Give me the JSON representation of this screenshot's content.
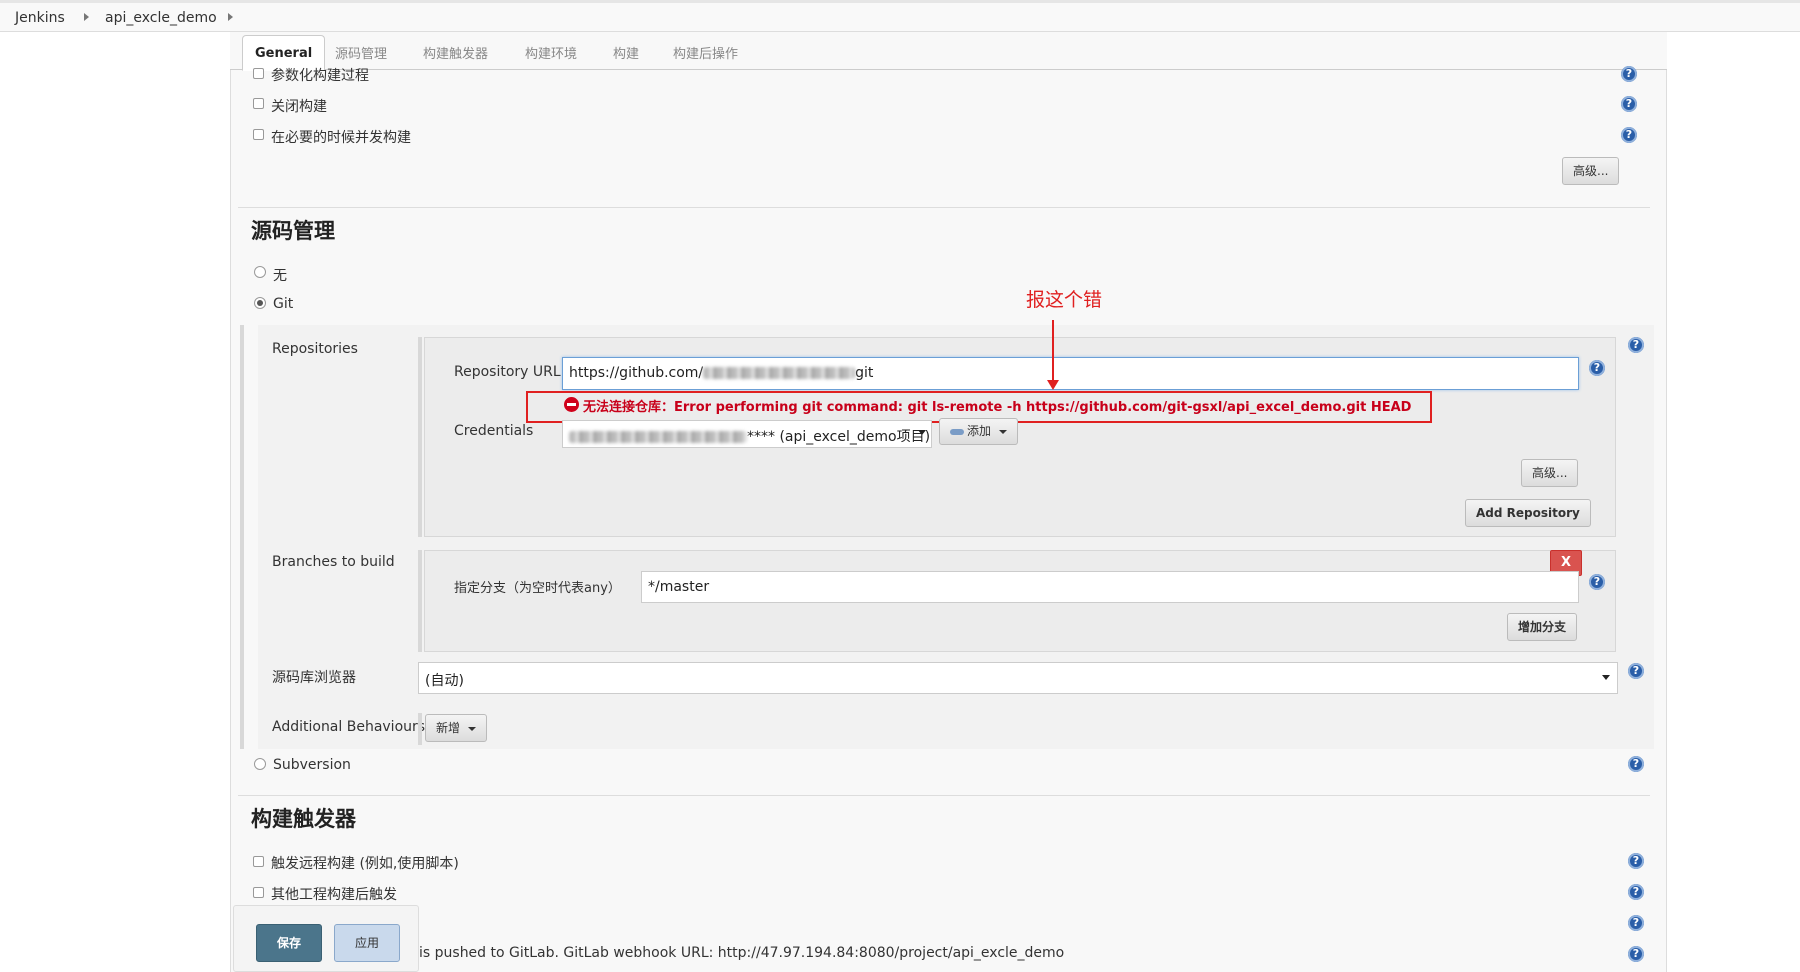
{
  "breadcrumb": {
    "root": "Jenkins",
    "project": "api_excle_demo"
  },
  "tabs": [
    "General",
    "源码管理",
    "构建触发器",
    "构建环境",
    "构建",
    "构建后操作"
  ],
  "general": {
    "opt_param": "参数化构建过程",
    "opt_disable": "关闭构建",
    "opt_concurrent": "在必要的时候并发构建",
    "advanced": "高级..."
  },
  "scm": {
    "title": "源码管理",
    "none_label": "无",
    "git_label": "Git",
    "repositories_label": "Repositories",
    "repo_url_label": "Repository URL",
    "repo_url_prefix": "https://github.com/",
    "repo_url_suffix": "git",
    "error_message": "无法连接仓库：Error performing git command: git ls-remote -h https://github.com/git-gsxl/api_excel_demo.git HEAD",
    "credentials_label": "Credentials",
    "credentials_value": "**** (api_excel_demo项目)",
    "add_button": "添加",
    "advanced": "高级...",
    "add_repository": "Add Repository",
    "branches_label": "Branches to build",
    "branch_specifier_label": "指定分支（为空时代表any）",
    "branch_value": "*/master",
    "remove_button": "X",
    "add_branch": "增加分支",
    "browser_label": "源码库浏览器",
    "browser_value": "(自动)",
    "behaviours_label": "Additional Behaviours",
    "behaviours_add": "新增",
    "subversion_label": "Subversion"
  },
  "annotation": {
    "text": "报这个错"
  },
  "triggers": {
    "title": "构建触发器",
    "opt_remote": "触发远程构建 (例如,使用脚本)",
    "opt_after_other": "其他工程构建后触发",
    "gitlab_text": "is pushed to GitLab. GitLab webhook URL: http://47.97.194.84:8080/project/api_excle_demo"
  },
  "footer": {
    "save": "保存",
    "apply": "应用"
  },
  "colors": {
    "error": "#e02020",
    "save": "#4b758b",
    "help": "#2a5ea8"
  },
  "help_icon_glyph": "?"
}
